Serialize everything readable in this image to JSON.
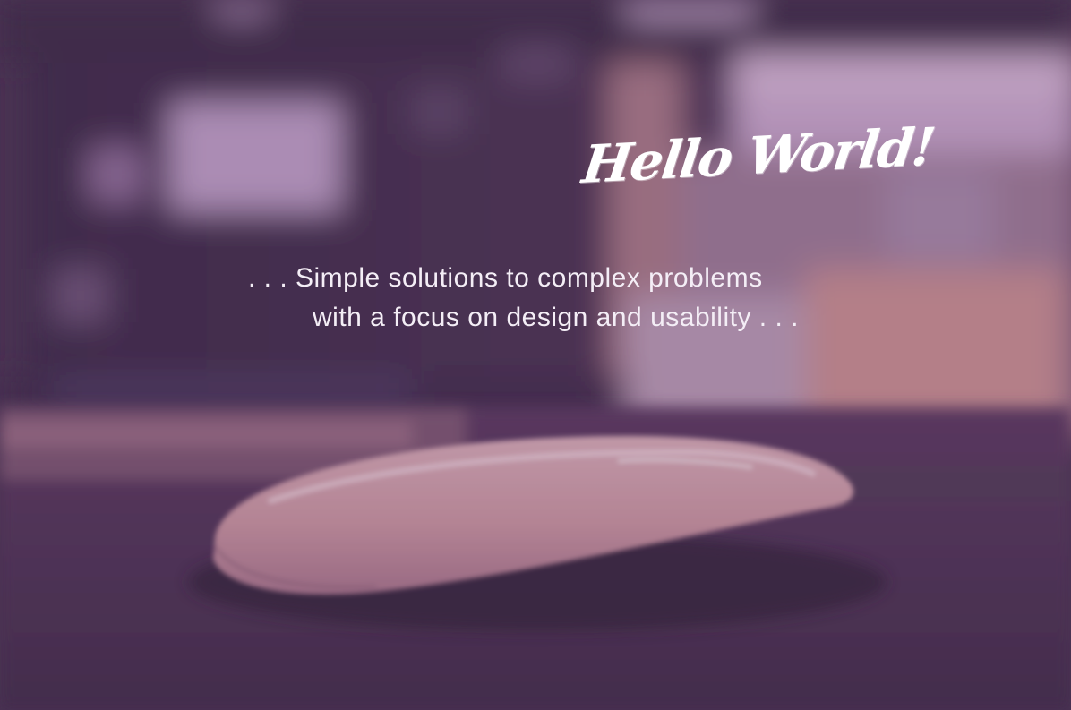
{
  "hero": {
    "title": "Hello World!",
    "tagline_line_1": ". . . Simple solutions to complex problems",
    "tagline_line_2": "with a focus on design and usability . . ."
  },
  "colors": {
    "background": "#4b3654",
    "text": "#ffffff",
    "tint": "#5a3264"
  }
}
